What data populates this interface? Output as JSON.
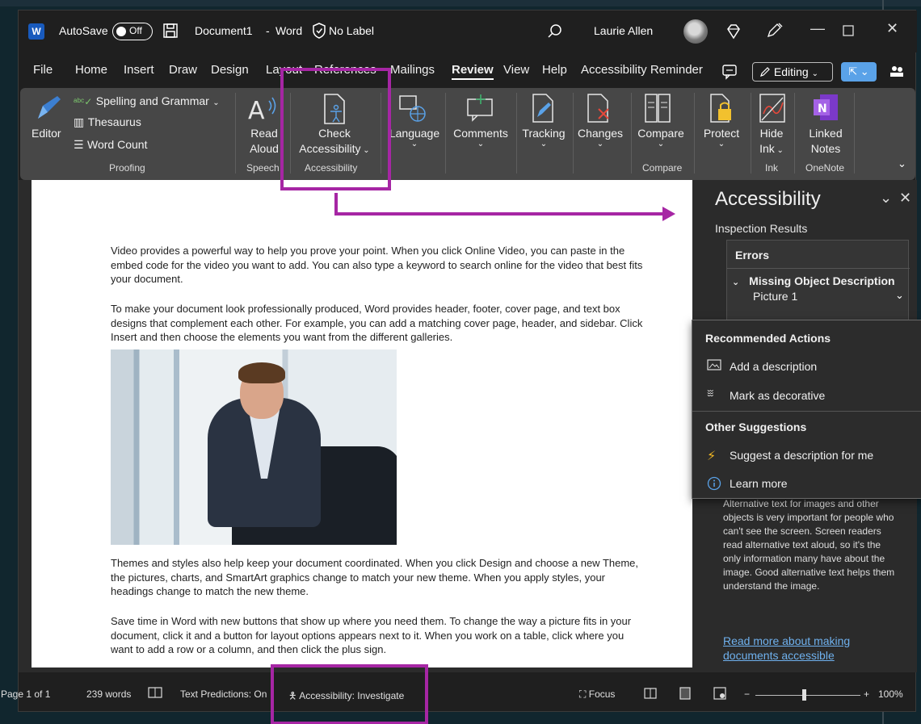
{
  "title_bar": {
    "autosave_label": "AutoSave",
    "autosave_state": "Off",
    "doc_title": "Document1",
    "separator": "-",
    "app_name": "Word",
    "label_text": "No Label",
    "user_name": "Laurie Allen"
  },
  "menu": {
    "items": [
      "File",
      "Home",
      "Insert",
      "Draw",
      "Design",
      "Layout",
      "References",
      "Mailings",
      "Review",
      "View",
      "Help",
      "Accessibility Reminder"
    ],
    "active": "Review",
    "editing_label": "Editing"
  },
  "ribbon": {
    "editor_label": "Editor",
    "spelling_label": "Spelling and Grammar",
    "thesaurus_label": "Thesaurus",
    "word_count_label": "Word Count",
    "proofing_group": "Proofing",
    "read_label": "Read",
    "aloud_label": "Aloud",
    "speech_group": "Speech",
    "check_label": "Check",
    "accessibility_label": "Accessibility",
    "accessibility_group": "Accessibility",
    "language_label": "Language",
    "comments_label": "Comments",
    "tracking_label": "Tracking",
    "changes_label": "Changes",
    "compare_label": "Compare",
    "compare_group": "Compare",
    "protect_label": "Protect",
    "hide_label": "Hide",
    "ink_label": "Ink",
    "ink_group": "Ink",
    "linked_label": "Linked",
    "notes_label": "Notes",
    "onenote_group": "OneNote"
  },
  "document": {
    "para1": "Video provides a powerful way to help you prove your point. When you click Online Video, you can paste in the embed code for the video you want to add. You can also type a keyword to search online for the video that best fits your document.",
    "para2": "To make your document look professionally produced, Word provides header, footer, cover page, and text box designs that complement each other. For example, you can add a matching cover page, header, and sidebar. Click Insert and then choose the elements you want from the different galleries.",
    "para3": "Themes and styles also help keep your document coordinated. When you click Design and choose a new Theme, the pictures, charts, and SmartArt graphics change to match your new theme. When you apply styles, your headings change to match the new theme.",
    "para4": "Save time in Word with new buttons that show up where you need them. To change the way a picture fits in your document, click it and a button for layout options appears next to it. When you work on a table, click where you want to add a row or a column, and then click the plus sign."
  },
  "pane": {
    "title": "Accessibility",
    "subtitle": "Inspection Results",
    "errors_heading": "Errors",
    "error_item": "Missing Object Description",
    "error_object": "Picture 1",
    "help_text": "Alternative text for images and other objects is very important for people who can't see the screen. Screen readers read alternative text aloud, so it's the only information many have about the image. Good alternative text helps them understand the image.",
    "help_link": "Read more about making documents accessible"
  },
  "context_menu": {
    "recommended_heading": "Recommended Actions",
    "add_description": "Add a description",
    "mark_decorative": "Mark as decorative",
    "other_heading": "Other Suggestions",
    "suggest_description": "Suggest a description for me",
    "learn_more": "Learn more"
  },
  "status_bar": {
    "page": "Page 1 of 1",
    "words": "239 words",
    "text_predictions": "Text Predictions: On",
    "accessibility": "Accessibility: Investigate",
    "focus": "Focus",
    "zoom_minus": "−",
    "zoom_plus": "+",
    "zoom": "100%"
  },
  "colors": {
    "annotation": "#a626a4",
    "link": "#6fb1ee",
    "word_blue": "#185abd"
  }
}
